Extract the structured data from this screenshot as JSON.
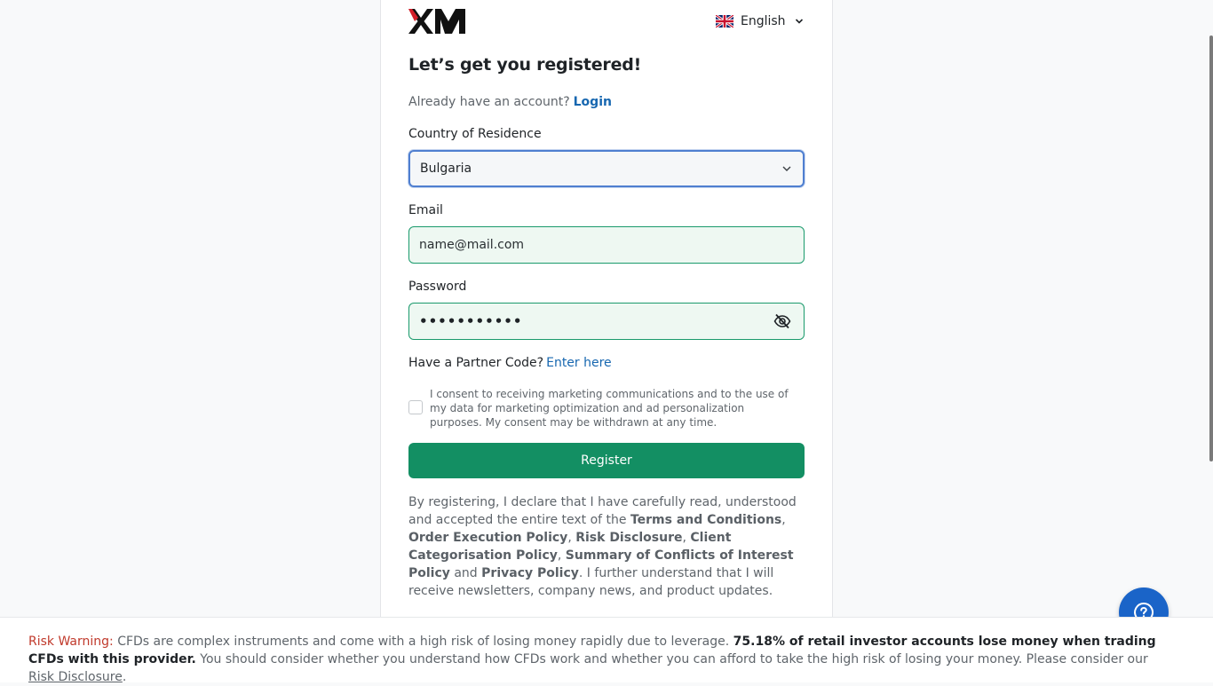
{
  "header": {
    "logo_text": "XM",
    "language": {
      "label": "English",
      "flag": "uk-flag-icon"
    }
  },
  "form": {
    "title": "Let’s get you registered!",
    "already_text": "Already have an account?",
    "login_link": "Login",
    "country": {
      "label": "Country of Residence",
      "value": "Bulgaria"
    },
    "email": {
      "label": "Email",
      "value": "name@mail.com"
    },
    "password": {
      "label": "Password",
      "masked_value": "•••••••••••"
    },
    "partner": {
      "text": "Have a Partner Code?",
      "link": "Enter here"
    },
    "consent": {
      "checked": false,
      "text": "I consent to receiving marketing communications and to the use of my data for marketing optimization and ad personalization purposes. My consent may be withdrawn at any time."
    },
    "register_label": "Register",
    "legal": {
      "p1": "By registering, I declare that I have carefully read, understood and accepted the entire text of the ",
      "terms": "Terms and Conditions",
      "sep1": ", ",
      "order": "Order Execution Policy",
      "sep2": ", ",
      "risk": "Risk Disclosure",
      "sep3": ", ",
      "client": "Client Categorisation Policy",
      "sep4": ", ",
      "conflicts": "Summary of Conflicts of Interest Policy",
      "and": " and ",
      "privacy": "Privacy Policy",
      "p2": ". I further understand that I will receive newsletters, company news, and product updates."
    }
  },
  "risk_warning": {
    "label": "Risk Warning:",
    "text1": " CFDs are complex instruments and come with a high risk of losing money rapidly due to leverage. ",
    "stat": "75.18% of retail investor accounts lose money when trading CFDs with this provider.",
    "text2": " You should consider whether you understand how CFDs work and whether you can afford to take the high risk of losing your money. Please consider our ",
    "link": "Risk Disclosure",
    "end": "."
  },
  "colors": {
    "brand_green": "#138f63",
    "link_blue": "#1767b0",
    "help_blue": "#1a64c8",
    "warning_red": "#c0392b"
  }
}
